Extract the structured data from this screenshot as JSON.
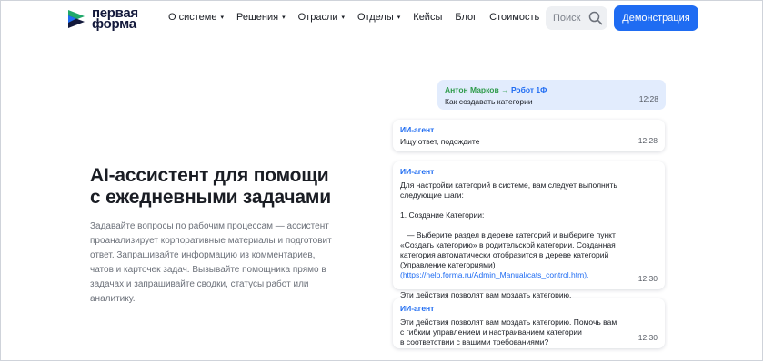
{
  "brand": {
    "logo_line1": "первая",
    "logo_line2": "форма",
    "color_dark": "#13193b",
    "color_accent": "#1f6cf2",
    "color_green": "#2e9b4b"
  },
  "nav": {
    "items": [
      {
        "label": "О системе",
        "dropdown": true
      },
      {
        "label": "Решения",
        "dropdown": true
      },
      {
        "label": "Отрасли",
        "dropdown": true
      },
      {
        "label": "Отделы",
        "dropdown": true
      },
      {
        "label": "Кейсы",
        "dropdown": false
      },
      {
        "label": "Блог",
        "dropdown": false
      },
      {
        "label": "Стоимость",
        "dropdown": false
      }
    ],
    "caret": "▾",
    "search_placeholder": "Поиск",
    "search_icon": "search-icon",
    "demo_label": "Демонстрация"
  },
  "hero": {
    "title_line1": "AI-ассистент для помощи",
    "title_line2": "с ежедневными задачами",
    "text": "Задавайте вопросы по рабочим процессам — ассистент проанализирует корпоративные материалы и подготовит ответ. Запрашивайте информацию из комментариев, чатов и карточек задач. Вызывайте помощника прямо в задачах и запрашивайте сводки, статусы работ или аналитику."
  },
  "chat": {
    "user_message": {
      "from": "Антон Марков",
      "arrow": "→",
      "to": "Робот 1Ф",
      "text": "Как создавать категории",
      "time": "12:28"
    },
    "agent_wait": {
      "sender": "ИИ-агент",
      "text": "Ищу ответ, подождите",
      "time": "12:28"
    },
    "agent_answer": {
      "sender": "ИИ-агент",
      "p1": "Для настройки категорий в системе, вам следует выполнить следующие шаги:",
      "p2": "1. Создание Категории:",
      "p3": "— Выберите раздел в дереве категорий и выберите пункт «Создать категорию» в родительской категории. Созданная категория автоматически отобразится в дереве категорий (Управление категориями)",
      "p3_link": "(https://help.forma.ru/Admin_Manual/cats_control.htm).",
      "p4": "Эти действия позволят вам моздать категорию.",
      "time": "12:30"
    },
    "agent_followup": {
      "sender": "ИИ-агент",
      "line1": "Эти действия позволят вам моздать категорию. Помочь вам",
      "line2": "с гибким управлением и настраиванием категории",
      "line3": "в соответствии с вашими требованиями?",
      "time": "12:30"
    }
  }
}
